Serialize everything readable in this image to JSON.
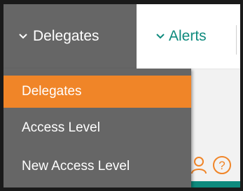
{
  "tabs": {
    "delegates": {
      "label": "Delegates",
      "icon": "chevron-down-icon",
      "active": true
    },
    "alerts": {
      "label": "Alerts",
      "icon": "chevron-down-icon",
      "active": false
    }
  },
  "dropdown": {
    "items": [
      {
        "label": "Delegates",
        "active": true
      },
      {
        "label": "Access Level",
        "active": false
      },
      {
        "label": "New Access Level",
        "active": false
      }
    ]
  },
  "toolbar_icons": [
    "user-icon",
    "help-circle-icon"
  ],
  "colors": {
    "active_tab_bg": "#666666",
    "accent_orange": "#f08528",
    "teal": "#0e8a7d"
  }
}
